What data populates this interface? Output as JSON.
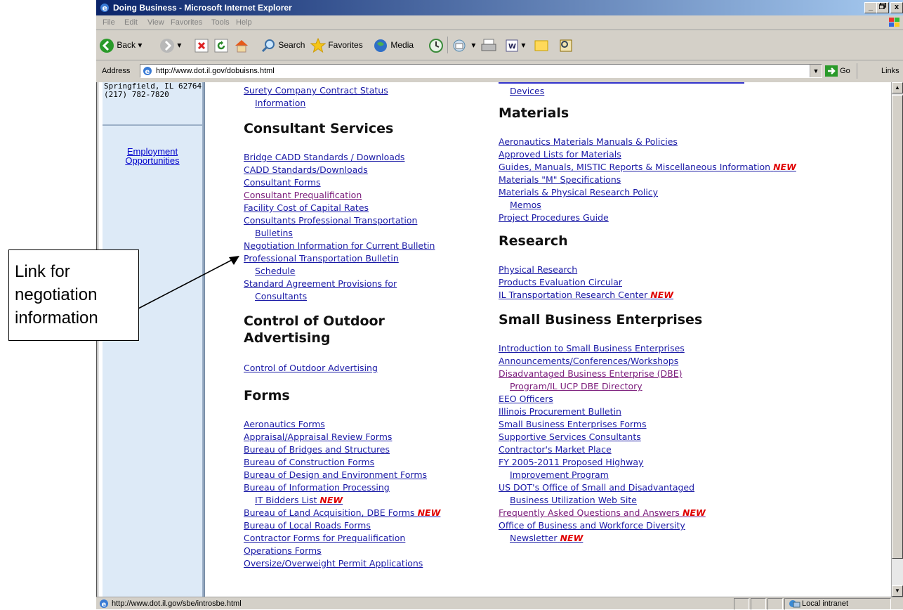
{
  "window": {
    "title": "Doing Business - Microsoft Internet Explorer",
    "min": "_",
    "max": " ",
    "close": "x"
  },
  "menu": {
    "items": [
      "File",
      "Edit",
      "View",
      "Favorites",
      "Tools",
      "Help"
    ]
  },
  "toolbar": {
    "back": "Back",
    "search": "Search",
    "favorites": "Favorites",
    "media": "Media"
  },
  "address": {
    "label": "Address",
    "url": "http://www.dot.il.gov/dobuisns.html",
    "go": "Go",
    "links": "Links"
  },
  "sidebar": {
    "address_lines": [
      "Springfield, IL 62764",
      "(217) 782-7820"
    ],
    "employment": "Employment Opportunities"
  },
  "left_column": {
    "surety": [
      "Surety Company Contract Status",
      "Information"
    ],
    "consultant": {
      "heading": "Consultant Services",
      "links": [
        "Bridge CADD Standards / Downloads",
        "CADD Standards/Downloads",
        "Consultant Forms",
        "Consultant Prequalification",
        "Facility Cost of Capital Rates",
        "Consultants Professional Transportation",
        "Bulletins",
        "Negotiation Information for Current Bulletin",
        "Professional Transportation Bulletin",
        "Schedule",
        "Standard Agreement Provisions for",
        "Consultants"
      ]
    },
    "outdoor": {
      "heading": [
        "Control of Outdoor",
        "Advertising"
      ],
      "link": "Control of Outdoor Advertising"
    },
    "forms": {
      "heading": "Forms",
      "links": [
        "Aeronautics Forms",
        "Appraisal/Appraisal Review Forms",
        "Bureau of Bridges and Structures",
        "Bureau of Construction Forms",
        "Bureau of Design and Environment Forms",
        "Bureau of Information Processing",
        "IT Bidders List",
        "Bureau of Land Acquisition, DBE Forms",
        "Bureau of Local Roads Forms",
        "Contractor Forms for Prequalification",
        "Operations Forms",
        "Oversize/Overweight Permit Applications"
      ]
    }
  },
  "right_column": {
    "devices": "Devices",
    "materials": {
      "heading": "Materials",
      "links": [
        "Aeronautics Materials Manuals & Policies",
        "Approved Lists for Materials",
        "Guides, Manuals, MISTIC Reports & Miscellaneous Information",
        "Materials \"M\" Specifications",
        "Materials & Physical Research Policy",
        "Memos",
        "Project Procedures Guide"
      ]
    },
    "research": {
      "heading": "Research",
      "links": [
        "Physical Research",
        "Products Evaluation Circular",
        "IL Transportation Research Center"
      ]
    },
    "sbe": {
      "heading": "Small Business Enterprises",
      "links": [
        "Introduction to Small Business Enterprises",
        "Announcements/Conferences/Workshops",
        "Disadvantaged Business Enterprise (DBE)",
        "Program/IL UCP DBE Directory",
        "EEO Officers",
        "Illinois Procurement Bulletin",
        "Small Business Enterprises Forms",
        "Supportive Services Consultants",
        "Contractor's Market Place",
        "FY 2005-2011 Proposed Highway",
        "Improvement Program",
        "US DOT's Office of Small and Disadvantaged",
        "Business Utilization Web Site",
        "Frequently Asked Questions and Answers",
        "Office of Business and Workforce Diversity",
        "Newsletter"
      ]
    }
  },
  "new_badge": "NEW",
  "status": {
    "url": "http://www.dot.il.gov/sbe/introsbe.html",
    "zone": "Local intranet"
  },
  "annotation": {
    "lines": [
      "Link for",
      "negotiation",
      "information"
    ]
  },
  "colors": {
    "link": "#1a1aa6",
    "visited": "#7a1a7a",
    "new": "#e00000",
    "sidebar": "#ddeaf7",
    "titlebar": "#0a246a"
  }
}
